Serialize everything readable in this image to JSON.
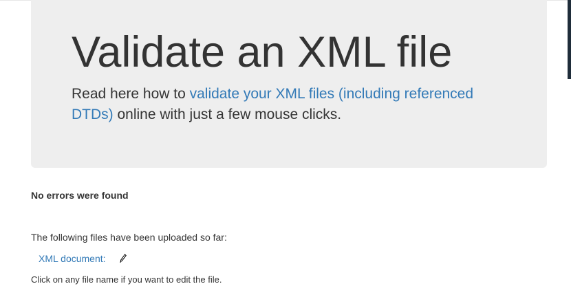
{
  "jumbotron": {
    "title": "Validate an XML file",
    "lead_before": "Read here how to ",
    "lead_link": "validate your XML files (including referenced DTDs)",
    "lead_after": " online with just a few mouse clicks."
  },
  "status": {
    "message": "No errors were found"
  },
  "uploads": {
    "intro": "The following files have been uploaded so far:",
    "files": [
      {
        "label": "XML document:",
        "icon": "pencil-icon"
      }
    ],
    "hint": "Click on any file name if you want to edit the file."
  },
  "colors": {
    "link": "#337ab7",
    "jumbotron_bg": "#eeeeee",
    "text": "#333333"
  }
}
